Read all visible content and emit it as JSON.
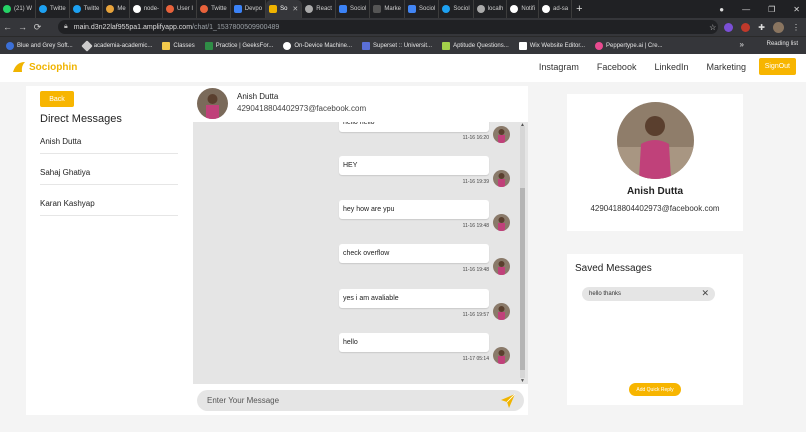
{
  "browser": {
    "tabs": [
      {
        "label": "(21) W",
        "icon": "whatsapp-icon",
        "color": "#25d366"
      },
      {
        "label": "Twitte",
        "icon": "twitter-icon",
        "color": "#1da1f2"
      },
      {
        "label": "Twitte",
        "icon": "twitter-icon",
        "color": "#1da1f2"
      },
      {
        "label": "Me",
        "icon": "chrome-icon",
        "color": "#e8a33b"
      },
      {
        "label": "node-",
        "icon": "github-icon",
        "color": "#ffffff"
      },
      {
        "label": "User I",
        "icon": "profile-icon",
        "color": "#e8623b"
      },
      {
        "label": "Twitte",
        "icon": "profile-icon",
        "color": "#e8623b"
      },
      {
        "label": "Devpo",
        "icon": "d-icon",
        "color": "#3b82f6"
      },
      {
        "label": "So",
        "icon": "sociophin-icon",
        "color": "#f0b400"
      },
      {
        "label": "React",
        "icon": "globe-icon",
        "color": "#aaaaaa"
      },
      {
        "label": "Sociol",
        "icon": "d-icon",
        "color": "#3b82f6"
      },
      {
        "label": "Marke",
        "icon": "page-icon",
        "color": "#555555"
      },
      {
        "label": "Sociol",
        "icon": "docs-icon",
        "color": "#4285f4"
      },
      {
        "label": "Sociol",
        "icon": "twitter-icon",
        "color": "#1da1f2"
      },
      {
        "label": "localh",
        "icon": "globe-icon",
        "color": "#aaaaaa"
      },
      {
        "label": "Notifi",
        "icon": "github-icon",
        "color": "#ffffff"
      },
      {
        "label": "ad-sa",
        "icon": "github-icon",
        "color": "#ffffff"
      }
    ],
    "new_tab": "+",
    "url_host": "main.d3n22laf955pa1.amplifyapp.com",
    "url_path": "/chat/1_1537800509900489",
    "bookmarks": [
      {
        "label": "Blue and Grey Soft...",
        "color": "#3b6fd6"
      },
      {
        "label": "academia-academic...",
        "color": "#cccccc"
      },
      {
        "label": "Classes",
        "color": "#f2c94c"
      },
      {
        "label": "Practice | GeeksFor...",
        "color": "#2f8d46"
      },
      {
        "label": "On-Device Machine...",
        "color": "#ffffff"
      },
      {
        "label": "Superset :: Universit...",
        "color": "#5a6fd6"
      },
      {
        "label": "Aptitude Questions...",
        "color": "#a3d14a"
      },
      {
        "label": "Wix Website Editor...",
        "color": "#ffffff"
      },
      {
        "label": "Peppertype.ai | Cre...",
        "color": "#e84a8f"
      }
    ],
    "bookmarks_more": "»",
    "reading_list": "Reading list"
  },
  "header": {
    "logo_text": "Sociophin",
    "nav": [
      "Instagram",
      "Facebook",
      "LinkedIn",
      "Marketing"
    ],
    "signout_label": "SignOut",
    "accent_color": "#f7b500"
  },
  "dm": {
    "back_label": "Back",
    "title": "Direct Messages",
    "contacts": [
      "Anish Dutta",
      "Sahaj Ghatiya",
      "Karan Kashyap"
    ]
  },
  "chat": {
    "name": "Anish Dutta",
    "email": "4290418804402973@facebook.com",
    "messages": [
      {
        "text": "hello hello",
        "time": "11-16 16:20"
      },
      {
        "text": "HEY",
        "time": "11-16 19:39"
      },
      {
        "text": "hey how are ypu",
        "time": "11-16 19:48"
      },
      {
        "text": "check overflow",
        "time": "11-16 19:48"
      },
      {
        "text": "yes i am avaliable",
        "time": "11-16 19:57"
      },
      {
        "text": "hello",
        "time": "11-17 05:14"
      }
    ],
    "input_placeholder": "Enter Your Message"
  },
  "profile": {
    "name": "Anish Dutta",
    "email": "4290418804402973@facebook.com"
  },
  "saved": {
    "title": "Saved Messages",
    "items": [
      "hello thanks"
    ],
    "quick_reply_label": "Add Quick Reply"
  }
}
